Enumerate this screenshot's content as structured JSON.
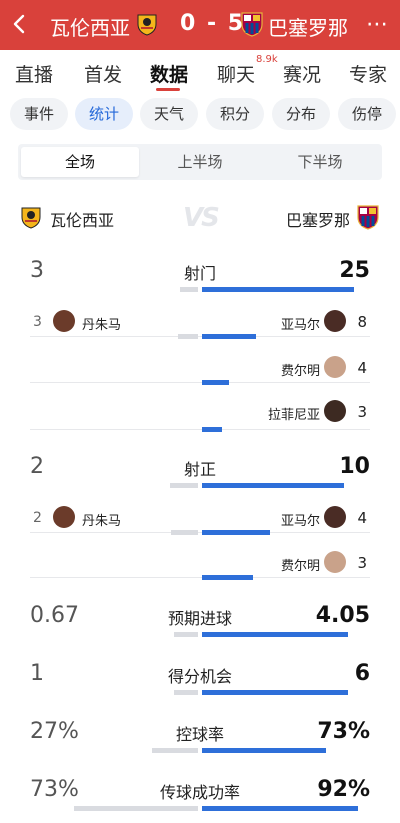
{
  "header": {
    "home_team": "瓦伦西亚",
    "score": "0 - 5",
    "away_team": "巴塞罗那",
    "more_icon": "⋯"
  },
  "main_tabs": [
    "直播",
    "首发",
    "数据",
    "聊天",
    "赛况",
    "专家"
  ],
  "main_tab_active": "数据",
  "chat_badge": "8.9k",
  "sub_tabs": [
    "事件",
    "统计",
    "天气",
    "积分",
    "分布",
    "伤停"
  ],
  "sub_tab_active": "统计",
  "period_tabs": [
    "全场",
    "上半场",
    "下半场"
  ],
  "period_active": "全场",
  "teams": {
    "home": "瓦伦西亚",
    "vs": "VS",
    "away": "巴塞罗那"
  },
  "colors": {
    "header": "#d9413b",
    "accent_blue": "#2e6fd9",
    "bar_grey": "#d9dbe0"
  },
  "stats": {
    "shots": {
      "label": "射门",
      "home": "3",
      "away": "25",
      "home_share": 0.107,
      "away_share": 0.893
    },
    "shots_players": [
      {
        "home_num": "3",
        "home_name": "丹朱马",
        "away_name": "亚马尔",
        "away_num": "8",
        "home_share": 0.12,
        "away_share": 0.32
      },
      {
        "away_name": "费尔明",
        "away_num": "4",
        "away_share": 0.16
      },
      {
        "away_name": "拉菲尼亚",
        "away_num": "3",
        "away_share": 0.12
      }
    ],
    "on_target": {
      "label": "射正",
      "home": "2",
      "away": "10",
      "home_share": 0.167,
      "away_share": 0.833
    },
    "on_target_players": [
      {
        "home_num": "2",
        "home_name": "丹朱马",
        "away_name": "亚马尔",
        "away_num": "4",
        "home_share": 0.16,
        "away_share": 0.4
      },
      {
        "away_name": "费尔明",
        "away_num": "3",
        "away_share": 0.3
      }
    ],
    "xg": {
      "label": "预期进球",
      "home": "0.67",
      "away": "4.05",
      "home_share": 0.142,
      "away_share": 0.858
    },
    "chances": {
      "label": "得分机会",
      "home": "1",
      "away": "6",
      "home_share": 0.143,
      "away_share": 0.857
    },
    "possession": {
      "label": "控球率",
      "home": "27%",
      "away": "73%",
      "home_share": 0.27,
      "away_share": 0.73
    },
    "pass_accuracy": {
      "label": "传球成功率",
      "home": "73%",
      "away": "92%",
      "home_share": 0.73,
      "away_share": 0.92
    }
  }
}
